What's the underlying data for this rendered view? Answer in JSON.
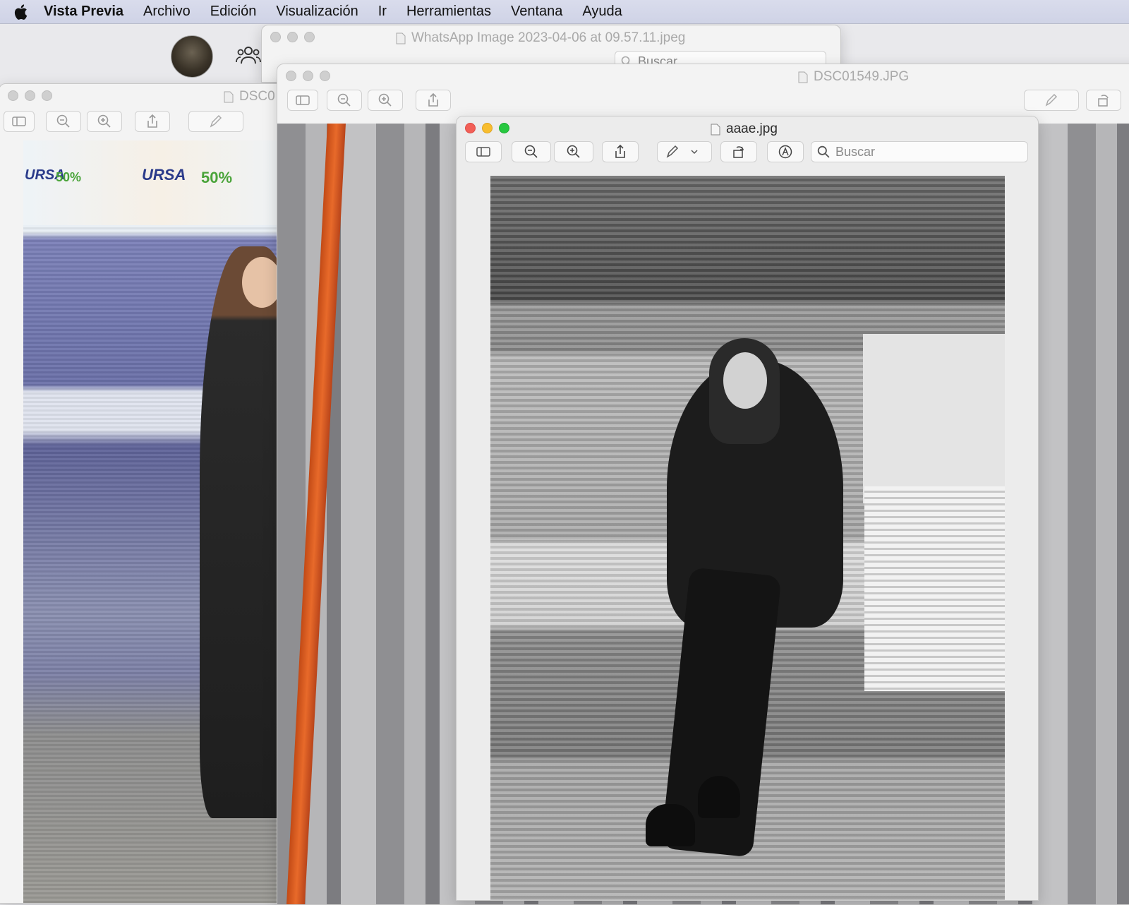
{
  "menubar": {
    "app_name": "Vista Previa",
    "items": [
      "Archivo",
      "Edición",
      "Visualización",
      "Ir",
      "Herramientas",
      "Ventana",
      "Ayuda"
    ]
  },
  "windows": {
    "back": {
      "title": "WhatsApp Image 2023-04-06 at 09.57.11.jpeg",
      "search_placeholder": "Buscar"
    },
    "left": {
      "title": "DSC0"
    },
    "middle": {
      "title": "DSC01549.JPG"
    },
    "front": {
      "title": "aaae.jpg",
      "search_placeholder": "Buscar"
    }
  },
  "photos": {
    "left_bag_text": [
      "URSA",
      "50%",
      "URSA",
      "50%"
    ]
  },
  "icons": [
    "apple-icon",
    "people-icon",
    "sidebar-toggle-icon",
    "zoom-out-icon",
    "zoom-in-icon",
    "share-icon",
    "markup-pen-icon",
    "rotate-icon",
    "annotate-icon",
    "search-icon",
    "document-icon"
  ],
  "colors": {
    "close": "#f25f57",
    "minimize": "#f8bd2e",
    "zoom": "#27c840",
    "menubar": "#d5d8ea"
  }
}
